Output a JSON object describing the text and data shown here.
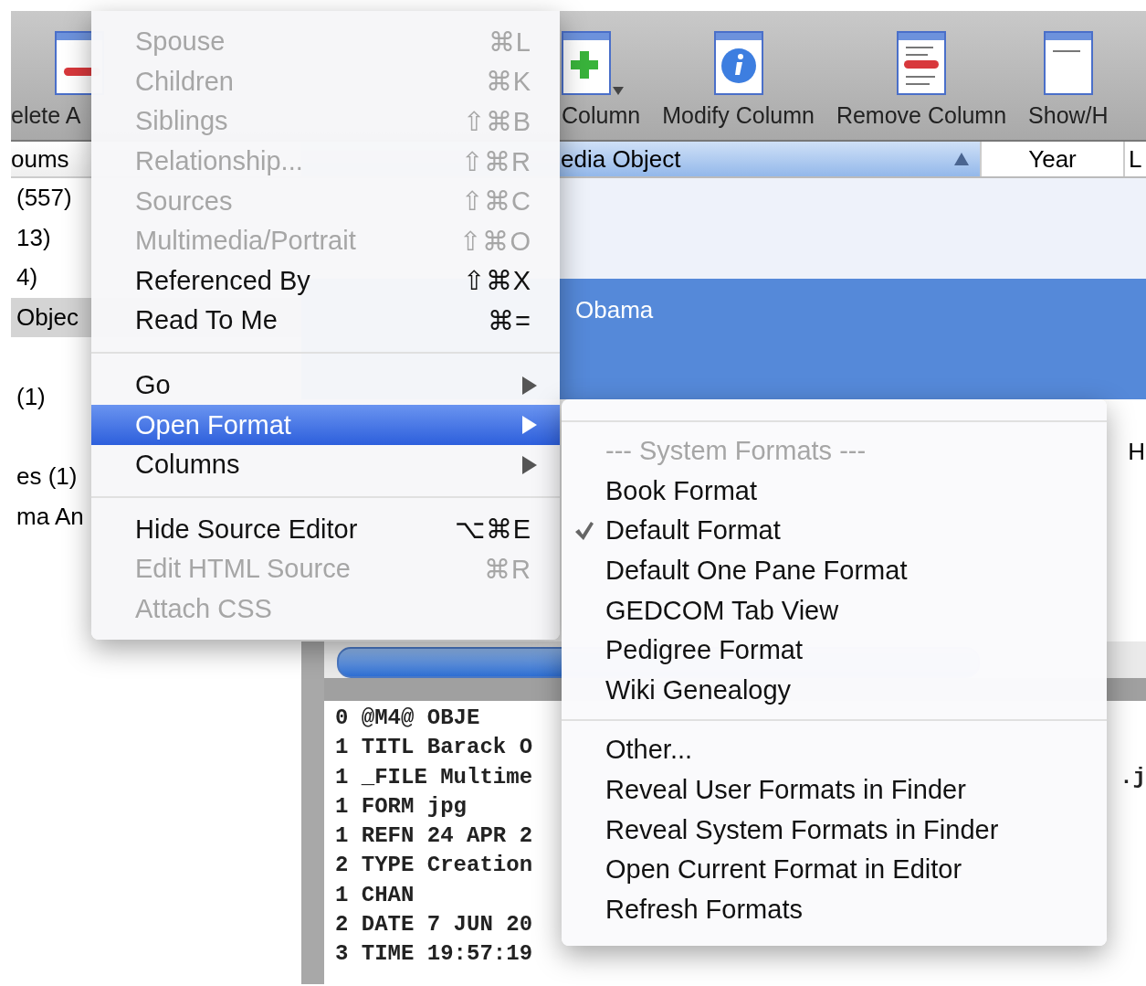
{
  "toolbar": {
    "left_item": {
      "label": "elete A"
    },
    "items": [
      {
        "label": "Column"
      },
      {
        "label": "Modify Column"
      },
      {
        "label": "Remove Column"
      },
      {
        "label": "Show/H"
      }
    ]
  },
  "sidebar": {
    "header": "oums",
    "groups": [
      {
        "items": [
          {
            "label": "(557)",
            "selected": false
          },
          {
            "label": "13)",
            "selected": false
          },
          {
            "label": "4)",
            "selected": false
          },
          {
            "label": "Objec",
            "selected": true
          }
        ]
      },
      {
        "items": [
          {
            "label": "(1)",
            "selected": false
          }
        ]
      },
      {
        "items": [
          {
            "label": "es (1)",
            "selected": false
          },
          {
            "label": "ma An",
            "selected": false
          }
        ]
      }
    ]
  },
  "table": {
    "columns": [
      {
        "label": "edia Object",
        "selected": true,
        "sorted": true
      },
      {
        "label": "Year",
        "selected": false,
        "sorted": false
      },
      {
        "label": "L",
        "selected": false,
        "sorted": false
      }
    ],
    "rows": [
      {
        "cell": "Obama",
        "selected": true
      }
    ],
    "side_text": "H"
  },
  "source": {
    "lines": [
      {
        "text": "0 @M4@ OBJE"
      },
      {
        "text": "1 TITL Barack O"
      },
      {
        "text": "1 _FILE Multime",
        "tail": ".j"
      },
      {
        "text": "1 FORM jpg"
      },
      {
        "text": "1 REFN 24 APR 2"
      },
      {
        "text": "2 TYPE Creation"
      },
      {
        "text": "1 CHAN"
      },
      {
        "text": "2 DATE 7 JUN 20"
      },
      {
        "text": "3 TIME 19:57:19"
      }
    ]
  },
  "menu": {
    "items": [
      {
        "kind": "item",
        "label": "Spouse",
        "shortcut": "⌘L",
        "disabled": true,
        "submenu": false,
        "selected": false
      },
      {
        "kind": "item",
        "label": "Children",
        "shortcut": "⌘K",
        "disabled": true,
        "submenu": false,
        "selected": false
      },
      {
        "kind": "item",
        "label": "Siblings",
        "shortcut": "⇧⌘B",
        "disabled": true,
        "submenu": false,
        "selected": false
      },
      {
        "kind": "item",
        "label": "Relationship...",
        "shortcut": "⇧⌘R",
        "disabled": true,
        "submenu": false,
        "selected": false
      },
      {
        "kind": "item",
        "label": "Sources",
        "shortcut": "⇧⌘C",
        "disabled": true,
        "submenu": false,
        "selected": false
      },
      {
        "kind": "item",
        "label": "Multimedia/Portrait",
        "shortcut": "⇧⌘O",
        "disabled": true,
        "submenu": false,
        "selected": false
      },
      {
        "kind": "item",
        "label": "Referenced By",
        "shortcut": "⇧⌘X",
        "disabled": false,
        "submenu": false,
        "selected": false
      },
      {
        "kind": "item",
        "label": "Read To Me",
        "shortcut": "⌘=",
        "disabled": false,
        "submenu": false,
        "selected": false
      },
      {
        "kind": "separator"
      },
      {
        "kind": "item",
        "label": "Go",
        "disabled": false,
        "submenu": true,
        "selected": false
      },
      {
        "kind": "item",
        "label": "Open Format",
        "disabled": false,
        "submenu": true,
        "selected": true
      },
      {
        "kind": "item",
        "label": "Columns",
        "disabled": false,
        "submenu": true,
        "selected": false
      },
      {
        "kind": "separator"
      },
      {
        "kind": "item",
        "label": "Hide Source Editor",
        "shortcut": "⌥⌘E",
        "disabled": false,
        "submenu": false,
        "selected": false
      },
      {
        "kind": "item",
        "label": "Edit HTML Source",
        "shortcut": "⌘R",
        "disabled": true,
        "submenu": false,
        "selected": false
      },
      {
        "kind": "item",
        "label": "Attach CSS",
        "disabled": true,
        "submenu": false,
        "selected": false
      }
    ]
  },
  "submenu": {
    "items": [
      {
        "kind": "separator"
      },
      {
        "kind": "item",
        "label": "--- System Formats ---",
        "disabled": true,
        "checked": false
      },
      {
        "kind": "item",
        "label": "Book Format",
        "disabled": false,
        "checked": false
      },
      {
        "kind": "item",
        "label": "Default Format",
        "disabled": false,
        "checked": true
      },
      {
        "kind": "item",
        "label": "Default One Pane Format",
        "disabled": false,
        "checked": false
      },
      {
        "kind": "item",
        "label": "GEDCOM Tab View",
        "disabled": false,
        "checked": false
      },
      {
        "kind": "item",
        "label": "Pedigree Format",
        "disabled": false,
        "checked": false
      },
      {
        "kind": "item",
        "label": "Wiki Genealogy",
        "disabled": false,
        "checked": false
      },
      {
        "kind": "separator"
      },
      {
        "kind": "item",
        "label": "Other...",
        "disabled": false,
        "checked": false
      },
      {
        "kind": "item",
        "label": "Reveal User Formats in Finder",
        "disabled": false,
        "checked": false
      },
      {
        "kind": "item",
        "label": "Reveal System Formats in Finder",
        "disabled": false,
        "checked": false
      },
      {
        "kind": "item",
        "label": "Open Current Format in Editor",
        "disabled": false,
        "checked": false
      },
      {
        "kind": "item",
        "label": "Refresh Formats",
        "disabled": false,
        "checked": false
      }
    ]
  }
}
